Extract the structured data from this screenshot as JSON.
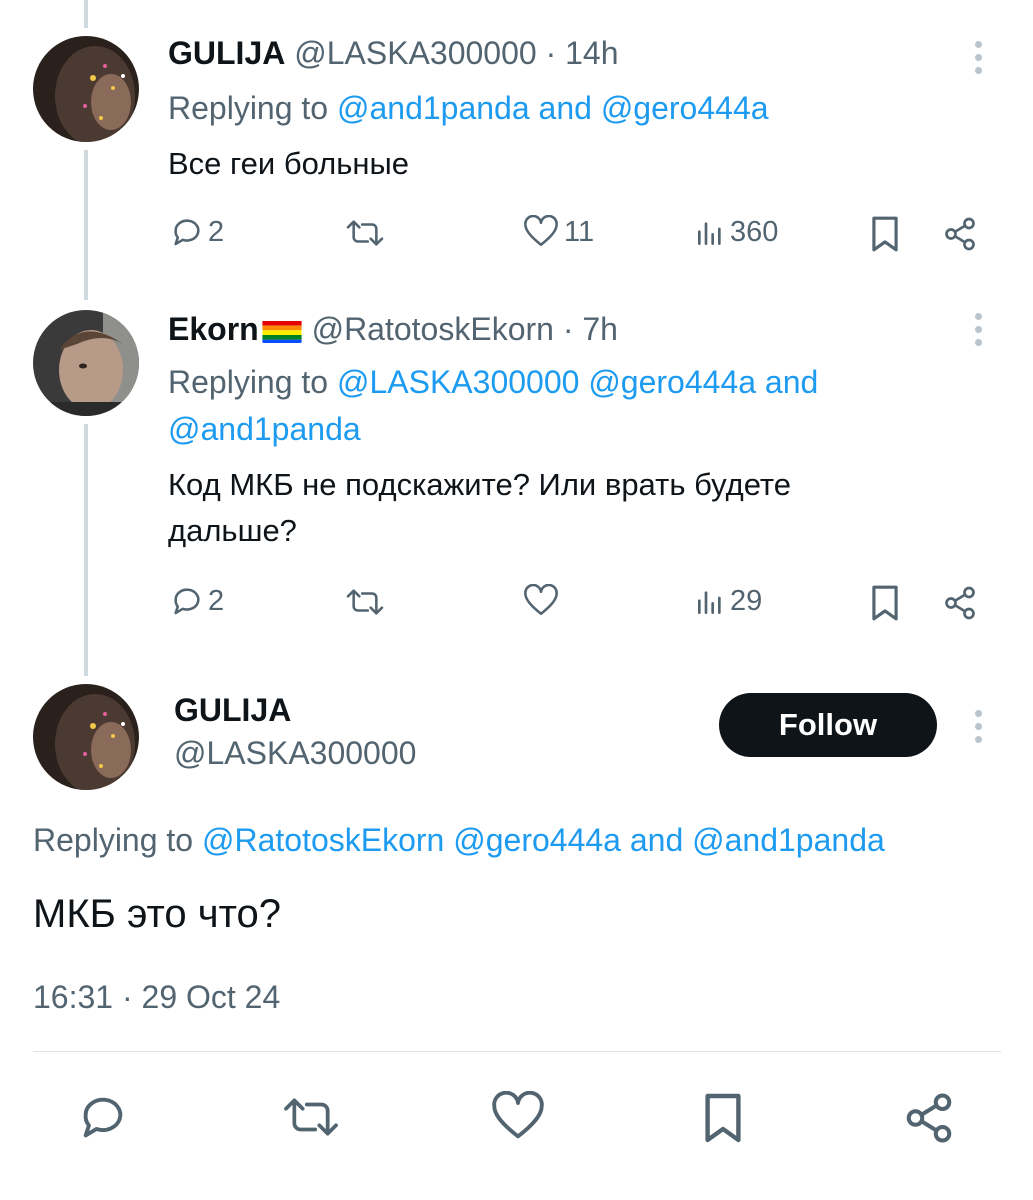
{
  "tweets": [
    {
      "name": "GULIJA",
      "handle": "@LASKA300000",
      "time": "· 14h",
      "replying_prefix": "Replying to ",
      "replying_1": "@and1panda",
      "replying_and": " and ",
      "replying_2": "@gero444a",
      "text": "Все геи больные",
      "replies": "2",
      "likes": "11",
      "views": "360"
    },
    {
      "name": "Ekorn",
      "flag": "rainbow-flag-emoji",
      "handle": "@RatotoskEkorn",
      "time": "· 7h",
      "replying_prefix": "Replying to ",
      "replying_1": "@LASKA300000",
      "replying_2": "@gero444a",
      "replying_and": " and",
      "replying_3": "@and1panda",
      "text_line1": "Код МКБ не подскажите? Или врать будете",
      "text_line2": "дальше?",
      "replies": "2",
      "likes": "",
      "views": "29"
    }
  ],
  "main": {
    "name": "GULIJA",
    "handle": "@LASKA300000",
    "follow_label": "Follow",
    "replying_prefix": "Replying to ",
    "replying_1": "@RatotoskEkorn",
    "replying_2": "@gero444a",
    "replying_and": " and ",
    "replying_3": "@and1panda",
    "text": "МКБ это что?",
    "timestamp": "16:31 · 29 Oct 24"
  },
  "icons": [
    "reply-icon",
    "retweet-icon",
    "like-icon",
    "views-icon",
    "bookmark-icon",
    "share-icon",
    "more-icon"
  ],
  "colors": {
    "link": "#1d9bf0",
    "muted": "#536471",
    "text": "#0f1419",
    "follow_bg": "#0f1419"
  }
}
